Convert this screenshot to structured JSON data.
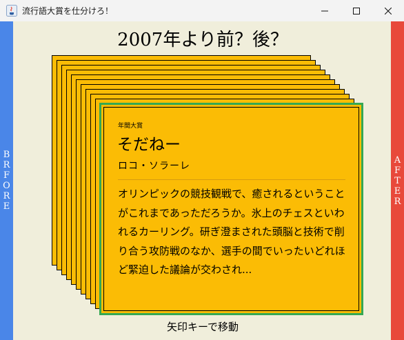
{
  "window": {
    "title": "流行語大賞を仕分けろ！",
    "icon": "java-cup-icon"
  },
  "sidebar_before": {
    "label": "BRFORE",
    "color": "#4a86e8"
  },
  "sidebar_after": {
    "label": "AFTER",
    "color": "#e8493a"
  },
  "question": "2007年より前？後？",
  "card": {
    "category": "年間大賞",
    "word": "そだねー",
    "person": "ロコ・ソラーレ",
    "description": "オリンピックの競技観戦で、癒されるということがこれまであっただろうか。氷上のチェスといわれるカーリング。研ぎ澄まされた頭脳と技術で削り合う攻防戦のなか、選手の間でいったいどれほど緊迫した議論が交わされ...",
    "color": "#fbbc05",
    "highlight_color": "#34a853"
  },
  "hint": "矢印キーで移動",
  "background_color": "#f0eedb"
}
